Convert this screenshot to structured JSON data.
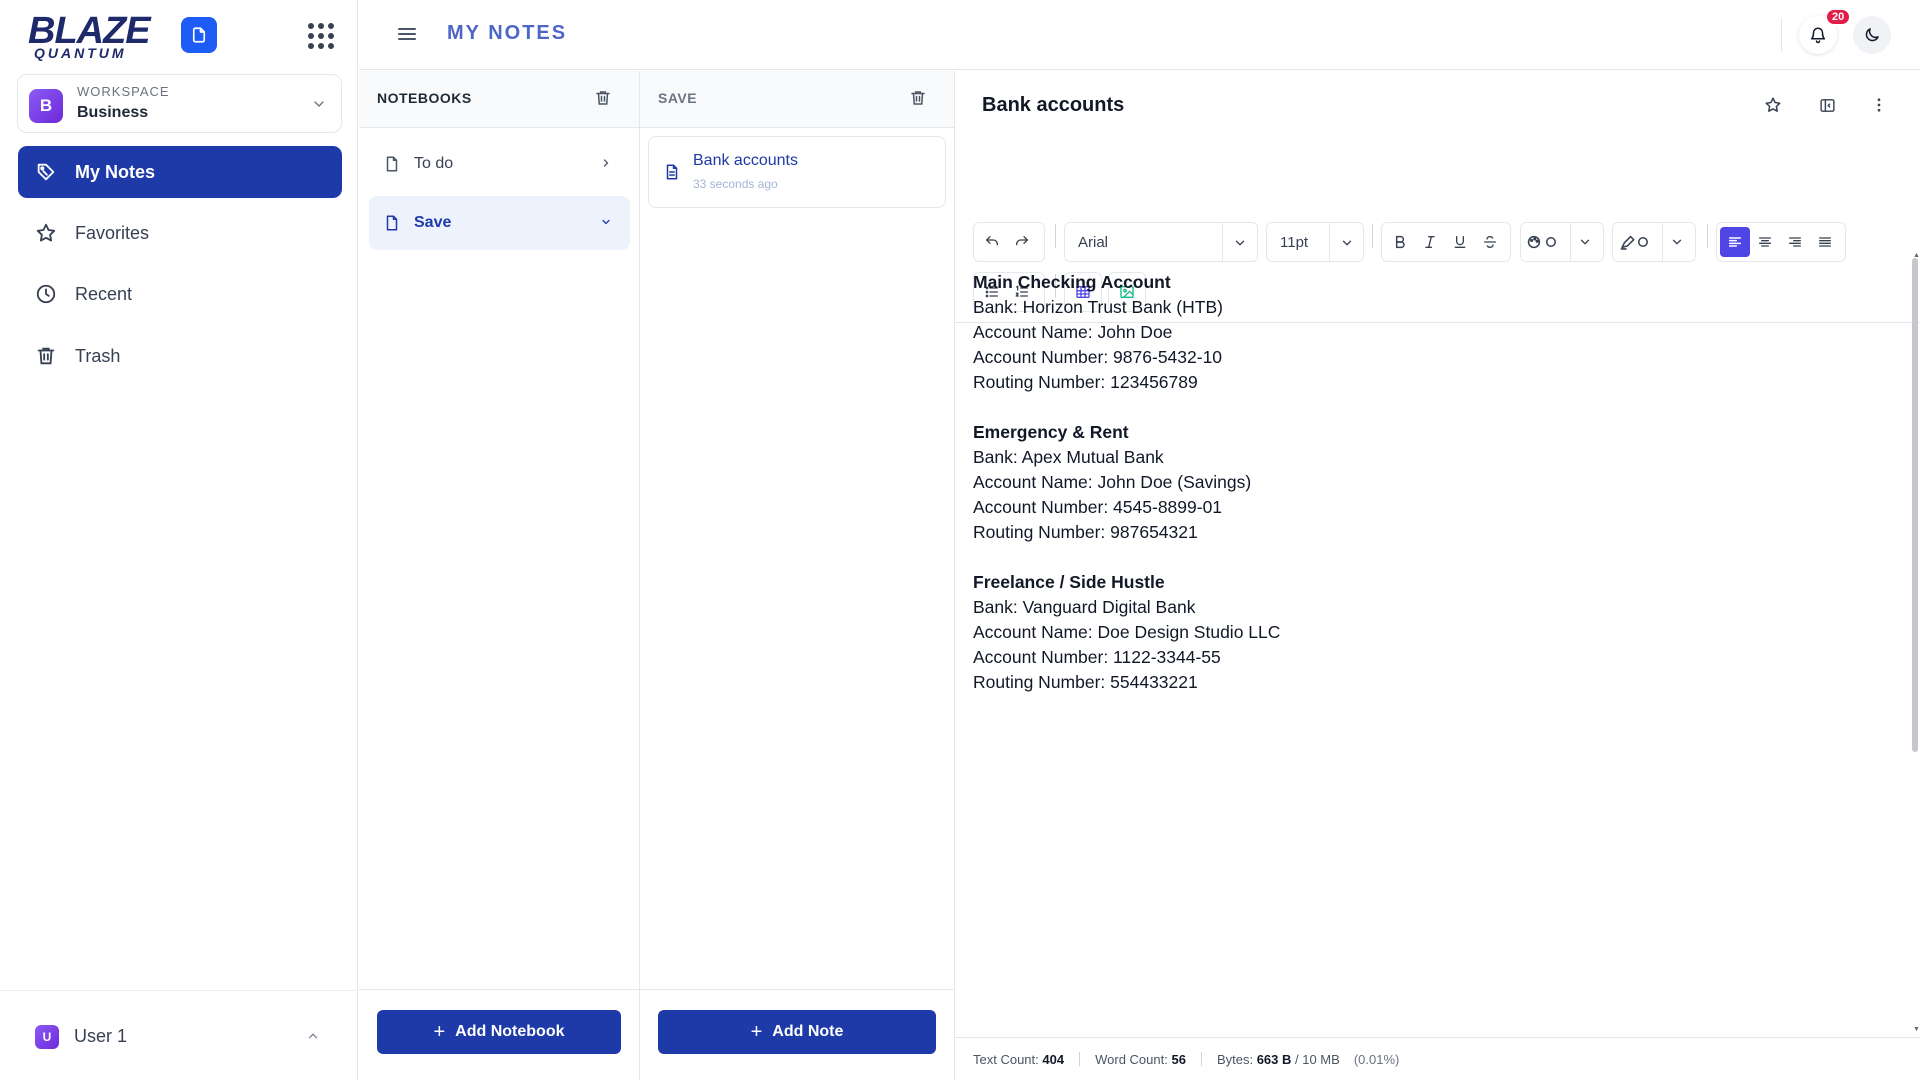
{
  "brand": {
    "line1": "BLAZE",
    "line2": "QUANTUM",
    "color": "#1f2a6b",
    "accent": "#1d5cf5"
  },
  "workspace": {
    "kicker": "WORKSPACE",
    "name": "Business",
    "initial": "B"
  },
  "sidebar": {
    "items": [
      {
        "label": "My Notes",
        "icon": "pencil-tag-icon",
        "active": true
      },
      {
        "label": "Favorites",
        "icon": "star-icon"
      },
      {
        "label": "Recent",
        "icon": "clock-icon"
      },
      {
        "label": "Trash",
        "icon": "trash-icon"
      }
    ],
    "user": {
      "name": "User 1",
      "initial": "U"
    }
  },
  "header": {
    "title": "MY NOTES",
    "notification_count": "20"
  },
  "notebooks": {
    "heading": "NOTEBOOKS",
    "items": [
      {
        "label": "To do",
        "expanded": false
      },
      {
        "label": "Save",
        "expanded": true,
        "active": true
      }
    ],
    "add_label": "Add Notebook"
  },
  "notes": {
    "heading": "SAVE",
    "items": [
      {
        "title": "Bank accounts",
        "time": "33 seconds ago"
      }
    ],
    "add_label": "Add Note"
  },
  "editor": {
    "title": "Bank accounts",
    "font": "Arial",
    "font_size": "11pt",
    "alignment": "left",
    "sections": [
      {
        "heading": "Main Checking Account",
        "lines": [
          "Bank: Horizon Trust Bank (HTB)",
          "Account Name: John Doe",
          "Account Number: 9876-5432-10",
          "Routing Number: 123456789"
        ]
      },
      {
        "heading": "Emergency & Rent",
        "lines": [
          "Bank: Apex Mutual Bank",
          "Account Name: John Doe (Savings)",
          "Account Number: 4545-8899-01",
          "Routing Number: 987654321"
        ]
      },
      {
        "heading": "Freelance / Side Hustle",
        "lines": [
          "Bank: Vanguard Digital Bank",
          "Account Name: Doe Design Studio LLC",
          "Account Number: 1122-3344-55",
          "Routing Number: 554433221"
        ]
      }
    ]
  },
  "status": {
    "text_count_label": "Text Count:",
    "text_count": "404",
    "word_count_label": "Word Count:",
    "word_count": "56",
    "bytes_label": "Bytes:",
    "bytes": "663 B",
    "bytes_limit": "/ 10 MB",
    "percent": "(0.01%)"
  },
  "colors": {
    "primary": "#1e3aa8",
    "active_align": "#4f46e5",
    "badge": "#e11d48",
    "title_blue": "#4f66c7"
  }
}
